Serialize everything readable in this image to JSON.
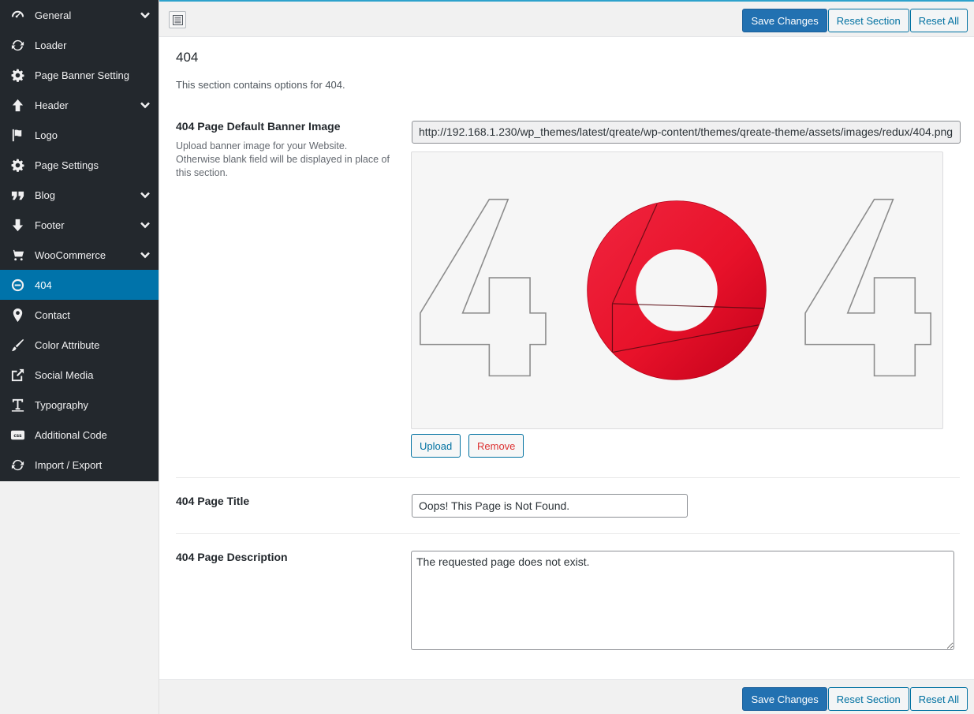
{
  "sidebar": {
    "items": [
      {
        "label": "General",
        "icon": "dashboard-icon",
        "chevron": true
      },
      {
        "label": "Loader",
        "icon": "refresh-icon",
        "chevron": false
      },
      {
        "label": "Page Banner Setting",
        "icon": "gear-icon",
        "chevron": false
      },
      {
        "label": "Header",
        "icon": "arrow-up-icon",
        "chevron": true
      },
      {
        "label": "Logo",
        "icon": "flag-icon",
        "chevron": false
      },
      {
        "label": "Page Settings",
        "icon": "gear-icon",
        "chevron": false
      },
      {
        "label": "Blog",
        "icon": "quote-icon",
        "chevron": true
      },
      {
        "label": "Footer",
        "icon": "arrow-down-icon",
        "chevron": true
      },
      {
        "label": "WooCommerce",
        "icon": "cart-icon",
        "chevron": true
      },
      {
        "label": "404",
        "icon": "minus-circle-icon",
        "chevron": false,
        "active": true
      },
      {
        "label": "Contact",
        "icon": "location-pin-icon",
        "chevron": false
      },
      {
        "label": "Color Attribute",
        "icon": "brush-icon",
        "chevron": false
      },
      {
        "label": "Social Media",
        "icon": "share-icon",
        "chevron": false
      },
      {
        "label": "Typography",
        "icon": "text-icon",
        "chevron": false
      },
      {
        "label": "Additional Code",
        "icon": "css-icon",
        "chevron": false
      },
      {
        "label": "Import / Export",
        "icon": "refresh-icon",
        "chevron": false
      }
    ]
  },
  "toolbar": {
    "save_label": "Save Changes",
    "reset_section_label": "Reset Section",
    "reset_all_label": "Reset All"
  },
  "section": {
    "title": "404",
    "description": "This section contains options for 404."
  },
  "fields": {
    "banner": {
      "label": "404 Page Default Banner Image",
      "subtitle": "Upload banner image for your Website. Otherwise blank field will be displayed in place of this section.",
      "url": "http://192.168.1.230/wp_themes/latest/qreate/wp-content/themes/qreate-theme/assets/images/redux/404.png",
      "upload_label": "Upload",
      "remove_label": "Remove"
    },
    "title": {
      "label": "404 Page Title",
      "value": "Oops! This Page is Not Found."
    },
    "description": {
      "label": "404 Page Description",
      "value": "The requested page does not exist."
    }
  },
  "colors": {
    "sidebar_bg": "#23282d",
    "active_bg": "#0073aa",
    "primary_button": "#2271b1",
    "banner_red": "#e8122a"
  }
}
